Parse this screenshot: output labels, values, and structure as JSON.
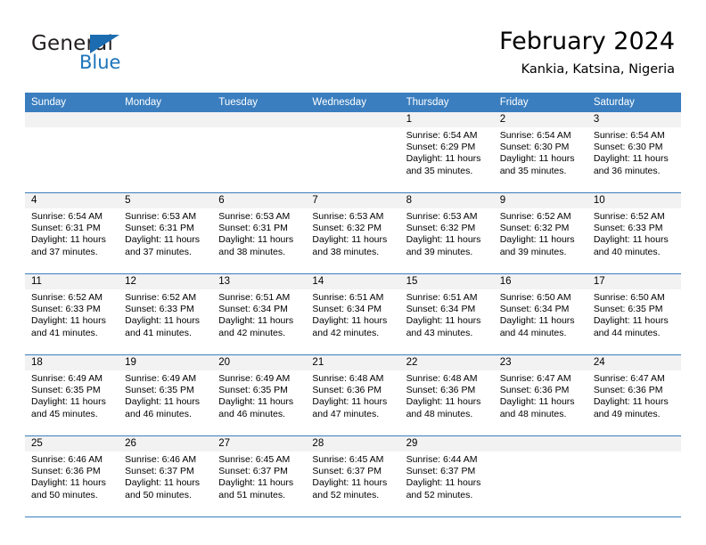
{
  "brand": {
    "word1": "General",
    "word2": "Blue",
    "logo_icon": "triangle-logo-icon",
    "accent_color": "#1b6cb0"
  },
  "header": {
    "title": "February 2024",
    "subtitle": "Kankia, Katsina, Nigeria"
  },
  "colors": {
    "header_row": "#3a7ebf",
    "daynum_band": "#f2f2f2",
    "grid_line": "#3a7ebf"
  },
  "calendar": {
    "weekday_headers": [
      "Sunday",
      "Monday",
      "Tuesday",
      "Wednesday",
      "Thursday",
      "Friday",
      "Saturday"
    ],
    "weeks": [
      [
        {
          "day": "",
          "sunrise": "",
          "sunset": "",
          "daylight": "",
          "empty": true
        },
        {
          "day": "",
          "sunrise": "",
          "sunset": "",
          "daylight": "",
          "empty": true
        },
        {
          "day": "",
          "sunrise": "",
          "sunset": "",
          "daylight": "",
          "empty": true
        },
        {
          "day": "",
          "sunrise": "",
          "sunset": "",
          "daylight": "",
          "empty": true
        },
        {
          "day": "1",
          "sunrise": "Sunrise: 6:54 AM",
          "sunset": "Sunset: 6:29 PM",
          "daylight": "Daylight: 11 hours and 35 minutes."
        },
        {
          "day": "2",
          "sunrise": "Sunrise: 6:54 AM",
          "sunset": "Sunset: 6:30 PM",
          "daylight": "Daylight: 11 hours and 35 minutes."
        },
        {
          "day": "3",
          "sunrise": "Sunrise: 6:54 AM",
          "sunset": "Sunset: 6:30 PM",
          "daylight": "Daylight: 11 hours and 36 minutes."
        }
      ],
      [
        {
          "day": "4",
          "sunrise": "Sunrise: 6:54 AM",
          "sunset": "Sunset: 6:31 PM",
          "daylight": "Daylight: 11 hours and 37 minutes."
        },
        {
          "day": "5",
          "sunrise": "Sunrise: 6:53 AM",
          "sunset": "Sunset: 6:31 PM",
          "daylight": "Daylight: 11 hours and 37 minutes."
        },
        {
          "day": "6",
          "sunrise": "Sunrise: 6:53 AM",
          "sunset": "Sunset: 6:31 PM",
          "daylight": "Daylight: 11 hours and 38 minutes."
        },
        {
          "day": "7",
          "sunrise": "Sunrise: 6:53 AM",
          "sunset": "Sunset: 6:32 PM",
          "daylight": "Daylight: 11 hours and 38 minutes."
        },
        {
          "day": "8",
          "sunrise": "Sunrise: 6:53 AM",
          "sunset": "Sunset: 6:32 PM",
          "daylight": "Daylight: 11 hours and 39 minutes."
        },
        {
          "day": "9",
          "sunrise": "Sunrise: 6:52 AM",
          "sunset": "Sunset: 6:32 PM",
          "daylight": "Daylight: 11 hours and 39 minutes."
        },
        {
          "day": "10",
          "sunrise": "Sunrise: 6:52 AM",
          "sunset": "Sunset: 6:33 PM",
          "daylight": "Daylight: 11 hours and 40 minutes."
        }
      ],
      [
        {
          "day": "11",
          "sunrise": "Sunrise: 6:52 AM",
          "sunset": "Sunset: 6:33 PM",
          "daylight": "Daylight: 11 hours and 41 minutes."
        },
        {
          "day": "12",
          "sunrise": "Sunrise: 6:52 AM",
          "sunset": "Sunset: 6:33 PM",
          "daylight": "Daylight: 11 hours and 41 minutes."
        },
        {
          "day": "13",
          "sunrise": "Sunrise: 6:51 AM",
          "sunset": "Sunset: 6:34 PM",
          "daylight": "Daylight: 11 hours and 42 minutes."
        },
        {
          "day": "14",
          "sunrise": "Sunrise: 6:51 AM",
          "sunset": "Sunset: 6:34 PM",
          "daylight": "Daylight: 11 hours and 42 minutes."
        },
        {
          "day": "15",
          "sunrise": "Sunrise: 6:51 AM",
          "sunset": "Sunset: 6:34 PM",
          "daylight": "Daylight: 11 hours and 43 minutes."
        },
        {
          "day": "16",
          "sunrise": "Sunrise: 6:50 AM",
          "sunset": "Sunset: 6:34 PM",
          "daylight": "Daylight: 11 hours and 44 minutes."
        },
        {
          "day": "17",
          "sunrise": "Sunrise: 6:50 AM",
          "sunset": "Sunset: 6:35 PM",
          "daylight": "Daylight: 11 hours and 44 minutes."
        }
      ],
      [
        {
          "day": "18",
          "sunrise": "Sunrise: 6:49 AM",
          "sunset": "Sunset: 6:35 PM",
          "daylight": "Daylight: 11 hours and 45 minutes."
        },
        {
          "day": "19",
          "sunrise": "Sunrise: 6:49 AM",
          "sunset": "Sunset: 6:35 PM",
          "daylight": "Daylight: 11 hours and 46 minutes."
        },
        {
          "day": "20",
          "sunrise": "Sunrise: 6:49 AM",
          "sunset": "Sunset: 6:35 PM",
          "daylight": "Daylight: 11 hours and 46 minutes."
        },
        {
          "day": "21",
          "sunrise": "Sunrise: 6:48 AM",
          "sunset": "Sunset: 6:36 PM",
          "daylight": "Daylight: 11 hours and 47 minutes."
        },
        {
          "day": "22",
          "sunrise": "Sunrise: 6:48 AM",
          "sunset": "Sunset: 6:36 PM",
          "daylight": "Daylight: 11 hours and 48 minutes."
        },
        {
          "day": "23",
          "sunrise": "Sunrise: 6:47 AM",
          "sunset": "Sunset: 6:36 PM",
          "daylight": "Daylight: 11 hours and 48 minutes."
        },
        {
          "day": "24",
          "sunrise": "Sunrise: 6:47 AM",
          "sunset": "Sunset: 6:36 PM",
          "daylight": "Daylight: 11 hours and 49 minutes."
        }
      ],
      [
        {
          "day": "25",
          "sunrise": "Sunrise: 6:46 AM",
          "sunset": "Sunset: 6:36 PM",
          "daylight": "Daylight: 11 hours and 50 minutes."
        },
        {
          "day": "26",
          "sunrise": "Sunrise: 6:46 AM",
          "sunset": "Sunset: 6:37 PM",
          "daylight": "Daylight: 11 hours and 50 minutes."
        },
        {
          "day": "27",
          "sunrise": "Sunrise: 6:45 AM",
          "sunset": "Sunset: 6:37 PM",
          "daylight": "Daylight: 11 hours and 51 minutes."
        },
        {
          "day": "28",
          "sunrise": "Sunrise: 6:45 AM",
          "sunset": "Sunset: 6:37 PM",
          "daylight": "Daylight: 11 hours and 52 minutes."
        },
        {
          "day": "29",
          "sunrise": "Sunrise: 6:44 AM",
          "sunset": "Sunset: 6:37 PM",
          "daylight": "Daylight: 11 hours and 52 minutes."
        },
        {
          "day": "",
          "sunrise": "",
          "sunset": "",
          "daylight": "",
          "empty": true
        },
        {
          "day": "",
          "sunrise": "",
          "sunset": "",
          "daylight": "",
          "empty": true
        }
      ]
    ]
  }
}
